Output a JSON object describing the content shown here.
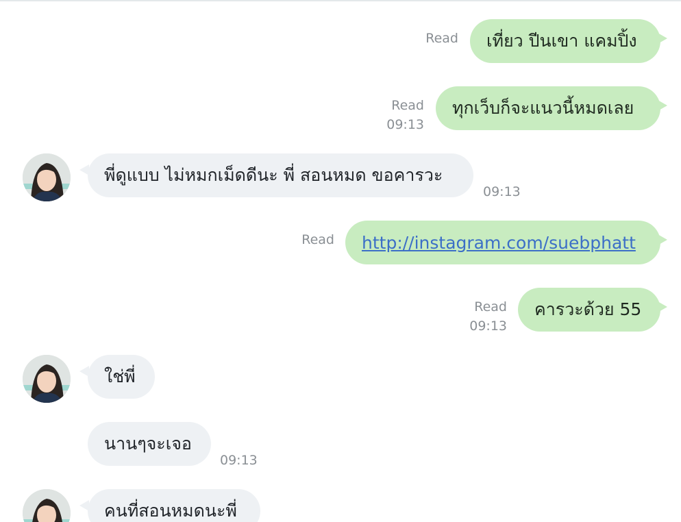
{
  "messages": [
    {
      "dir": "out",
      "text": "เที่ยว ปีนเขา แคมปิ้ง",
      "read": "Read",
      "time": ""
    },
    {
      "dir": "out",
      "text": "ทุกเว็บก็จะแนวนี้หมดเลย",
      "read": "Read",
      "time": "09:13"
    },
    {
      "dir": "in",
      "text": "พี่ดูแบบ ไม่หมกเม็ดดีนะ พี่ สอนหมด ขอคารวะ",
      "time": "09:13"
    },
    {
      "dir": "out",
      "link": "http://instagram.com/suebphatt",
      "read": "Read",
      "time": ""
    },
    {
      "dir": "out",
      "text": "คารวะด้วย 55",
      "read": "Read",
      "time": "09:13"
    },
    {
      "dir": "in",
      "text": "ใช่พี่",
      "time": ""
    },
    {
      "dir": "in",
      "text": "นานๆจะเจอ",
      "time": "09:13"
    },
    {
      "dir": "in",
      "text": "คนที่สอนหมดนะพี่",
      "time": ""
    }
  ],
  "avatar_icon": "contact-avatar",
  "colors": {
    "outgoing_bubble": "#c8ecc0",
    "incoming_bubble": "#eef1f4",
    "link": "#3c6fc7",
    "meta_text": "#8a8f94"
  }
}
